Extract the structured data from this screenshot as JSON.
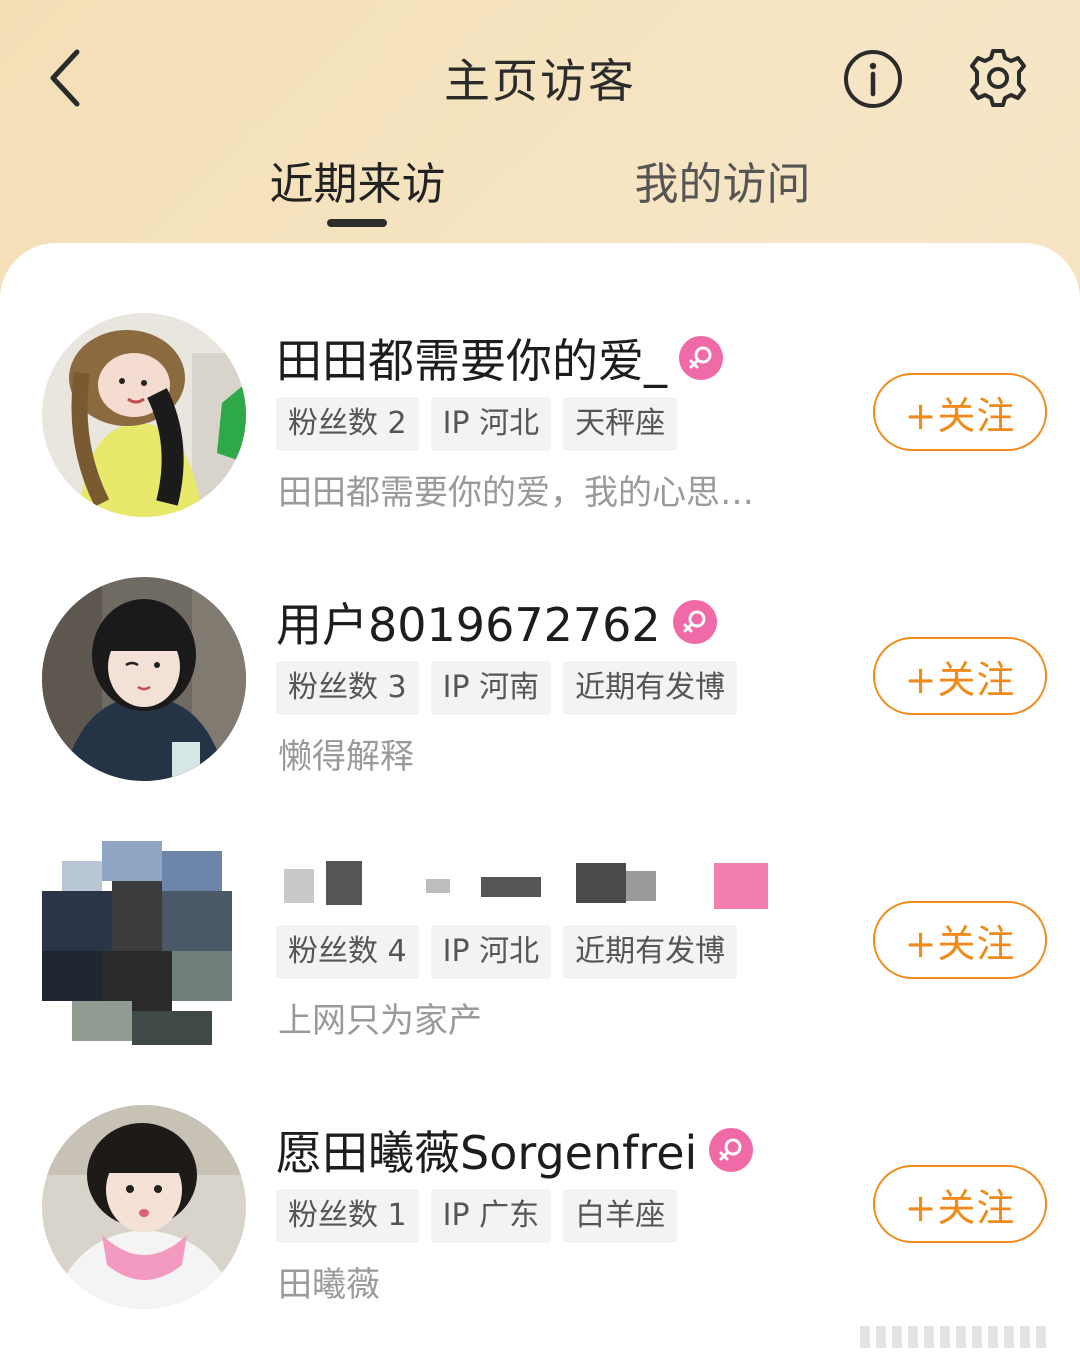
{
  "header": {
    "title": "主页访客",
    "back_icon": "chevron-left-icon",
    "info_icon": "info-icon",
    "settings_icon": "gear-icon"
  },
  "tabs": [
    {
      "label": "近期来访",
      "active": true
    },
    {
      "label": "我的访问",
      "active": false
    }
  ],
  "visitors": [
    {
      "name": "田田都需要你的爱_",
      "gender_icon": "female-icon",
      "tags": [
        "粉丝数 2",
        "IP 河北",
        "天秤座"
      ],
      "bio": "田田都需要你的爱，我的心思…",
      "follow_label": "+关注"
    },
    {
      "name": "用户8019672762",
      "gender_icon": "female-icon",
      "tags": [
        "粉丝数 3",
        "IP 河南",
        "近期有发博"
      ],
      "bio": "懒得解释",
      "follow_label": "+关注"
    },
    {
      "name": "",
      "blurred": true,
      "tags": [
        "粉丝数 4",
        "IP 河北",
        "近期有发博"
      ],
      "bio": "上网只为家产",
      "follow_label": "+关注"
    },
    {
      "name": "愿田曦薇Sorgenfrei",
      "gender_icon": "female-icon",
      "tags": [
        "粉丝数 1",
        "IP 广东",
        "白羊座"
      ],
      "bio": "田曦薇",
      "follow_label": "+关注"
    }
  ],
  "colors": {
    "accent": "#f08a1a",
    "female_badge": "#ef6aa6",
    "header_gradient_start": "#f3dfb6",
    "header_gradient_end": "#f1d8ab"
  }
}
